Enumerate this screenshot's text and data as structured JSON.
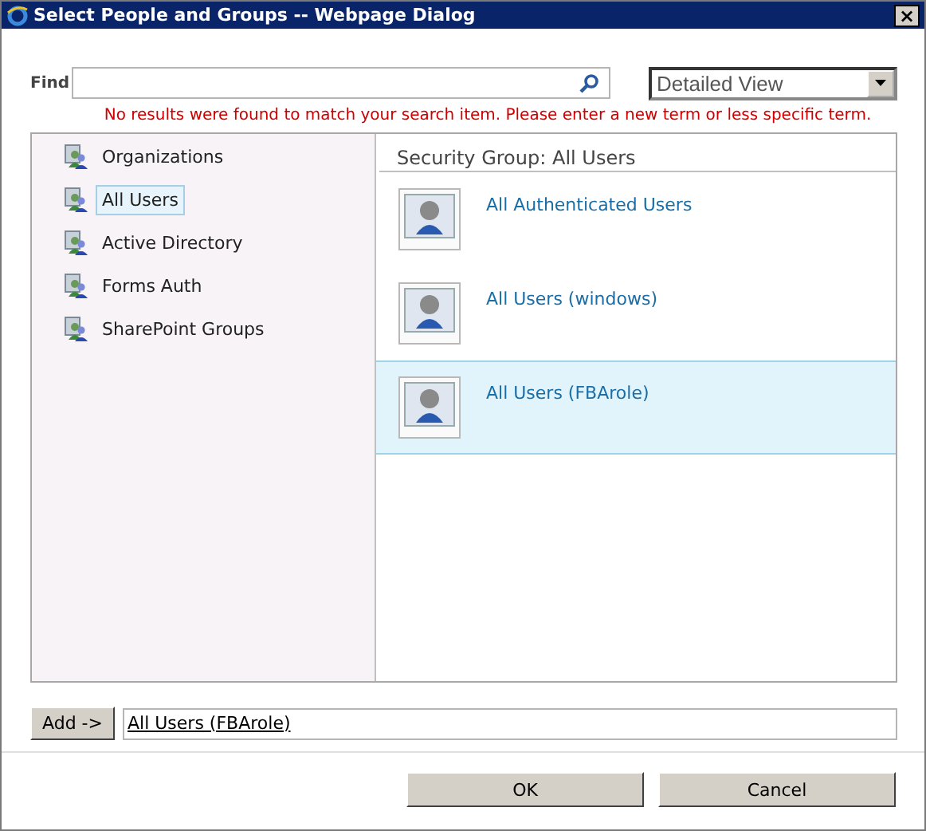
{
  "window": {
    "title": "Select People and Groups -- Webpage Dialog",
    "close": "×"
  },
  "find": {
    "label": "Find"
  },
  "view": {
    "value": "Detailed View"
  },
  "error": "No results were found to match your search item. Please enter a new term or less specific term.",
  "sources": [
    {
      "label": "Organizations",
      "selected": false
    },
    {
      "label": "All Users",
      "selected": true
    },
    {
      "label": "Active Directory",
      "selected": false
    },
    {
      "label": "Forms Auth",
      "selected": false
    },
    {
      "label": "SharePoint Groups",
      "selected": false
    }
  ],
  "results": {
    "heading": "Security Group: All Users",
    "items": [
      {
        "name": "All Authenticated Users",
        "selected": false
      },
      {
        "name": "All Users (windows)",
        "selected": false
      },
      {
        "name": "All Users (FBArole)",
        "selected": true
      }
    ]
  },
  "add": {
    "button": "Add ->",
    "value": "All Users (FBArole)"
  },
  "buttons": [
    "OK",
    "Cancel"
  ]
}
